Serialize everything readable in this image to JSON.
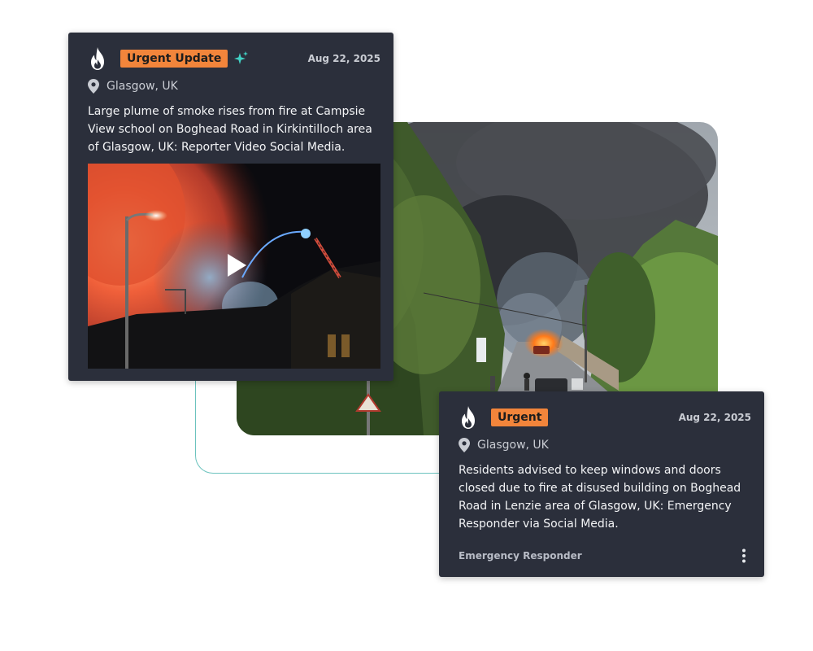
{
  "card_primary": {
    "badge": "Urgent Update",
    "date": "Aug 22, 2025",
    "location": "Glasgow, UK",
    "text": "Large plume of smoke rises from fire at Campsie View school on Boghead Road in Kirkintilloch area of Glasgow, UK: Reporter Video Social Media.",
    "icons": [
      "flame-logo-icon",
      "sparkle-icon",
      "location-pin-icon",
      "play-icon"
    ]
  },
  "card_secondary": {
    "badge": "Urgent",
    "date": "Aug 22, 2025",
    "location": "Glasgow, UK",
    "text": "Residents advised to keep windows and doors closed due to fire at disused building on Boghead Road in Lenzie area of Glasgow, UK: Emergency Responder via Social Media.",
    "source": "Emergency Responder",
    "icons": [
      "flame-logo-icon",
      "location-pin-icon",
      "more-vertical-icon"
    ]
  },
  "colors": {
    "card_bg": "#2b2f3b",
    "badge_orange": "#f2853b",
    "connector_teal": "#6cc3be",
    "sparkle_teal": "#41d1c4"
  }
}
